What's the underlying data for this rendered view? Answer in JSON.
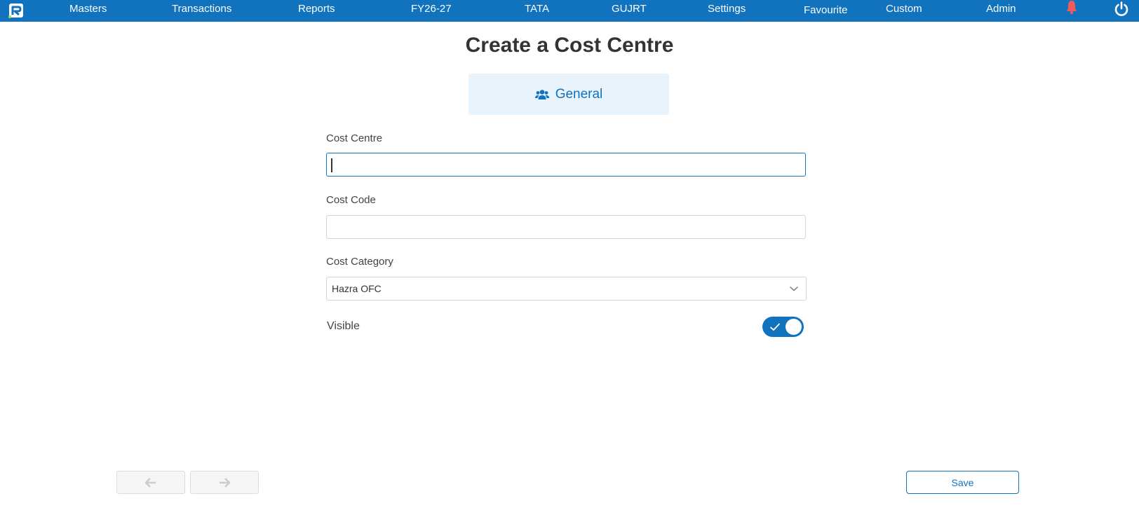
{
  "nav": {
    "items": [
      "Masters",
      "Transactions",
      "Reports",
      "FY26-27",
      "TATA",
      "GUJRT",
      "Settings",
      "Favourite",
      "Custom",
      "Admin"
    ]
  },
  "icons": {
    "logo": "app-logo-icon",
    "bell": "bell-icon",
    "power": "power-icon",
    "users": "users-icon",
    "chevron": "chevron-down-icon",
    "check": "check-icon",
    "prev": "arrow-left-icon",
    "next": "arrow-right-icon"
  },
  "colors": {
    "brand": "#1172be",
    "tab_bg": "#e8f3fc",
    "bell": "#f25b5b"
  },
  "page": {
    "title": "Create a Cost Centre",
    "tab_label": "General"
  },
  "form": {
    "cost_centre": {
      "label": "Cost Centre",
      "value": ""
    },
    "cost_code": {
      "label": "Cost Code",
      "value": ""
    },
    "cost_category": {
      "label": "Cost Category",
      "value": "Hazra OFC"
    },
    "visible": {
      "label": "Visible",
      "checked": true
    }
  },
  "footer": {
    "save_label": "Save"
  }
}
